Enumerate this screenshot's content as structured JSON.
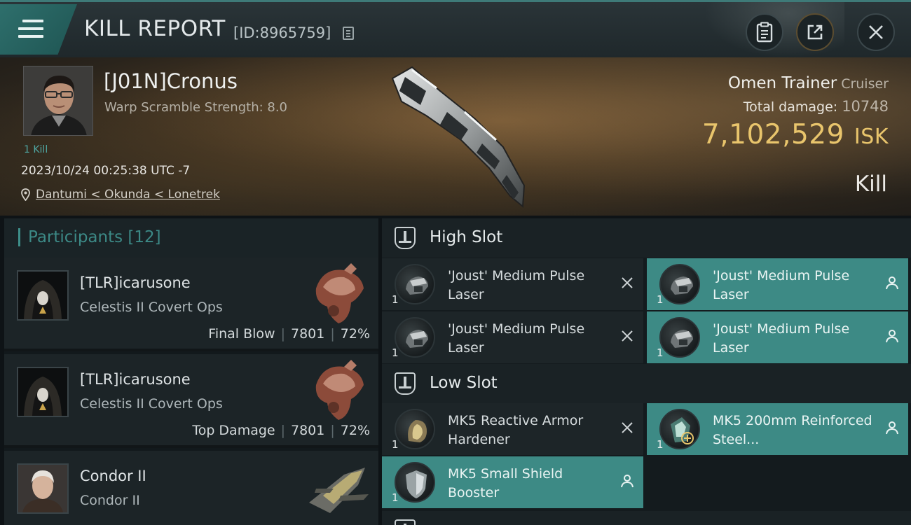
{
  "header": {
    "title": "KILL REPORT",
    "report_id": "[ID:8965759]"
  },
  "victim": {
    "name": "[J01N]Cronus",
    "scramble": "Warp Scramble Strength: 8.0",
    "kill_tag": "1 Kill",
    "datetime": "2023/10/24 00:25:38 UTC -7",
    "location": "Dantumi < Okunda < Lonetrek"
  },
  "ship": {
    "name": "Omen Trainer",
    "class": "Cruiser",
    "total_damage_label": "Total damage:",
    "total_damage": "10748",
    "isk_value": "7,102,529",
    "isk_unit": "ISK",
    "result": "Kill"
  },
  "participants": {
    "label": "Participants",
    "count": "[12]",
    "rows": [
      {
        "name": "[TLR]icarusone",
        "ship": "Celestis II Covert Ops",
        "tag": "Final Blow",
        "damage": "7801",
        "percent": "72%"
      },
      {
        "name": "[TLR]icarusone",
        "ship": "Celestis II Covert Ops",
        "tag": "Top Damage",
        "damage": "7801",
        "percent": "72%"
      },
      {
        "name": "Condor II",
        "ship": "Condor II"
      }
    ]
  },
  "slots": {
    "high": {
      "label": "High Slot",
      "modules": [
        {
          "name": "'Joust' Medium Pulse Laser",
          "qty": "1",
          "status": "destroyed"
        },
        {
          "name": "'Joust' Medium Pulse Laser",
          "qty": "1",
          "status": "dropped"
        },
        {
          "name": "'Joust' Medium Pulse Laser",
          "qty": "1",
          "status": "destroyed"
        },
        {
          "name": "'Joust' Medium Pulse Laser",
          "qty": "1",
          "status": "dropped"
        }
      ]
    },
    "low": {
      "label": "Low Slot",
      "modules": [
        {
          "name": "MK5 Reactive Armor Hardener",
          "qty": "1",
          "status": "destroyed"
        },
        {
          "name": "MK5 200mm Reinforced Steel...",
          "qty": "1",
          "status": "dropped"
        },
        {
          "name": "MK5 Small Shield Booster",
          "qty": "1",
          "status": "dropped"
        }
      ]
    }
  },
  "colors": {
    "accent": "#3d8a85",
    "isk": "#e9c56c"
  }
}
